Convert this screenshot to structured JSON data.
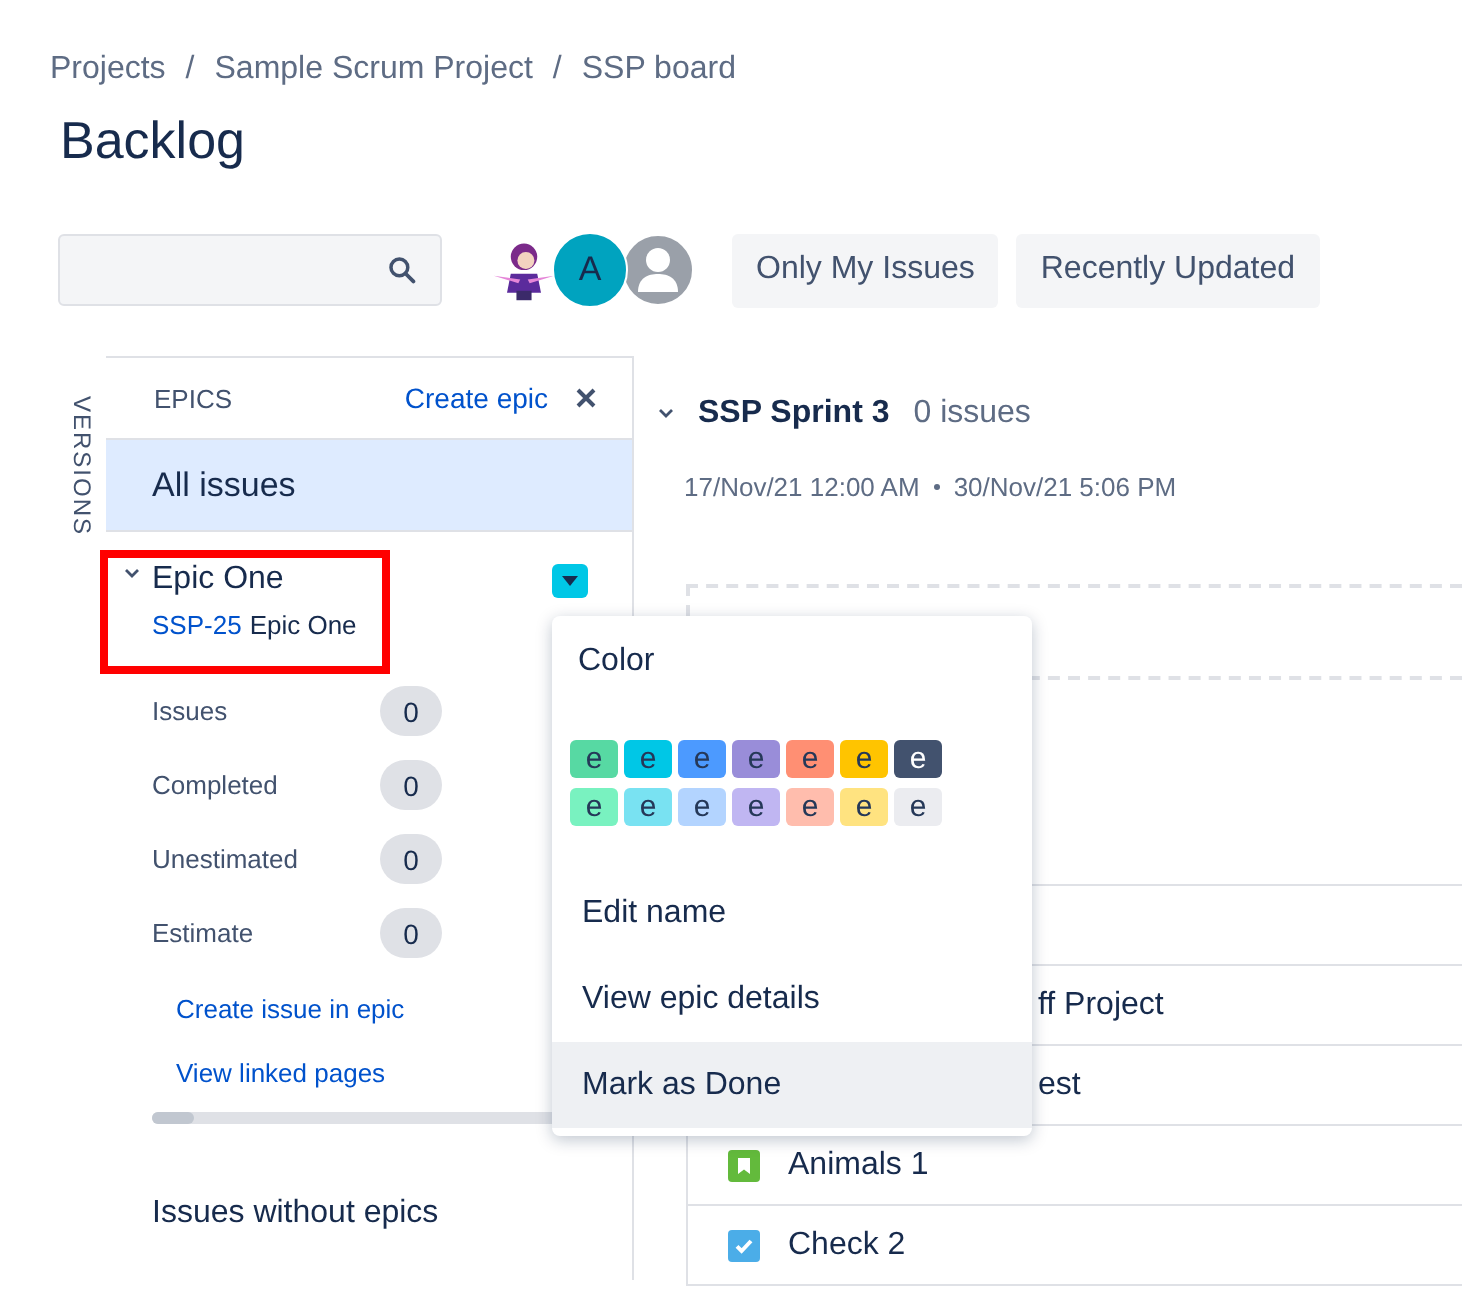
{
  "breadcrumbs": [
    "Projects",
    "Sample Scrum Project",
    "SSP board"
  ],
  "breadcrumb_separator": "/",
  "title": "Backlog",
  "avatars": [
    {
      "kind": "picture"
    },
    {
      "kind": "letter",
      "label": "A"
    },
    {
      "kind": "silhouette"
    }
  ],
  "filters": [
    {
      "label": "Only My Issues",
      "selected": false
    },
    {
      "label": "Recently Updated",
      "selected": false
    }
  ],
  "versions_tab": "VERSIONS",
  "epics_panel": {
    "heading": "EPICS",
    "create": "Create epic",
    "all_issues": {
      "label": "All issues",
      "selected": true
    },
    "epic": {
      "name": "Epic One",
      "key": "SSP-25",
      "summary": "Epic One",
      "expanded": true,
      "highlighted": true,
      "stats": [
        {
          "label": "Issues",
          "value": "0"
        },
        {
          "label": "Completed",
          "value": "0"
        },
        {
          "label": "Unestimated",
          "value": "0"
        },
        {
          "label": "Estimate",
          "value": "0"
        }
      ],
      "links": [
        "Create issue in epic",
        "View linked pages"
      ],
      "level": 0.1
    },
    "without_epics": "Issues without epics"
  },
  "sprint": {
    "name": "SSP Sprint 3",
    "count": "0 issues",
    "expanded": true,
    "start": "17/Nov/21 12:00 AM",
    "end": "30/Nov/21 5:06 PM"
  },
  "issues": [
    {
      "kind": "covered",
      "text": "ff Project"
    },
    {
      "kind": "covered",
      "text": "est"
    },
    {
      "kind": "story",
      "text": "Animals 1"
    },
    {
      "kind": "task",
      "text": "Check 2"
    }
  ],
  "menu": {
    "heading": "Color",
    "swatches": [
      [
        {
          "label": "e",
          "color": "#57d9a3"
        },
        {
          "label": "e",
          "color": "#00c7e6"
        },
        {
          "label": "e",
          "color": "#4c9aff"
        },
        {
          "label": "e",
          "color": "#998dd9"
        },
        {
          "label": "e",
          "color": "#ff8f73"
        },
        {
          "label": "e",
          "color": "#ffc400"
        },
        {
          "label": "e",
          "color": "#42526e"
        }
      ],
      [
        {
          "label": "e",
          "color": "#79f2c0"
        },
        {
          "label": "e",
          "color": "#79e2f2"
        },
        {
          "label": "e",
          "color": "#b3d4ff"
        },
        {
          "label": "e",
          "color": "#c0b6f2"
        },
        {
          "label": "e",
          "color": "#ffbdad"
        },
        {
          "label": "e",
          "color": "#ffe380"
        },
        {
          "label": "e",
          "color": "#ebecf0"
        }
      ]
    ],
    "items": [
      {
        "label": "Edit name",
        "selected": false
      },
      {
        "label": "View epic details",
        "selected": false
      },
      {
        "label": "Mark as Done",
        "selected": true
      }
    ]
  }
}
